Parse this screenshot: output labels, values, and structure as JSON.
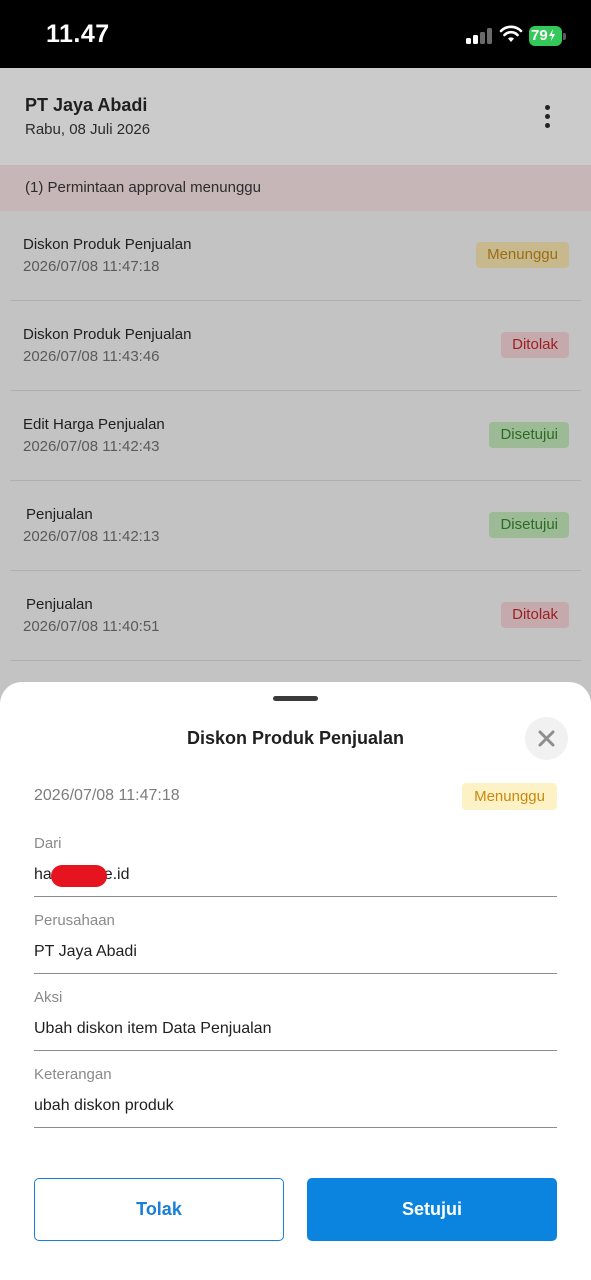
{
  "status_bar": {
    "time": "11.47",
    "battery": "79"
  },
  "header": {
    "company": "PT Jaya Abadi",
    "date": "Rabu, 08 Juli 2026"
  },
  "banner": {
    "text": "(1) Permintaan approval menunggu"
  },
  "requests": [
    {
      "title": "Diskon Produk Penjualan",
      "time": "2026/07/08 11:47:18",
      "status": "Menunggu"
    },
    {
      "title": "Diskon Produk Penjualan",
      "time": "2026/07/08 11:43:46",
      "status": "Ditolak"
    },
    {
      "title": "Edit Harga Penjualan",
      "time": "2026/07/08 11:42:43",
      "status": "Disetujui"
    },
    {
      "title": "Penjualan",
      "time": "2026/07/08 11:42:13",
      "status": "Disetujui"
    },
    {
      "title": "Penjualan",
      "time": "2026/07/08 11:40:51",
      "status": "Ditolak"
    }
  ],
  "sheet": {
    "title": "Diskon Produk Penjualan",
    "time": "2026/07/08 11:47:18",
    "status": "Menunggu",
    "fields": [
      {
        "label": "Dari",
        "value_prefix": "ha",
        "value_suffix": "ee.id"
      },
      {
        "label": "Perusahaan",
        "value": "PT Jaya Abadi"
      },
      {
        "label": "Aksi",
        "value": "Ubah diskon item Data Penjualan"
      },
      {
        "label": "Keterangan",
        "value": "ubah diskon produk"
      }
    ],
    "reject_label": "Tolak",
    "approve_label": "Setujui"
  },
  "colors": {
    "primary": "#0b84e0",
    "waiting": "#c9890f",
    "rejected": "#9d1f22",
    "approved": "#2a6c22",
    "battery": "#34c759"
  },
  "icons": [
    "signal-icon",
    "wifi-icon",
    "battery-icon",
    "more-vertical-icon",
    "close-icon"
  ]
}
